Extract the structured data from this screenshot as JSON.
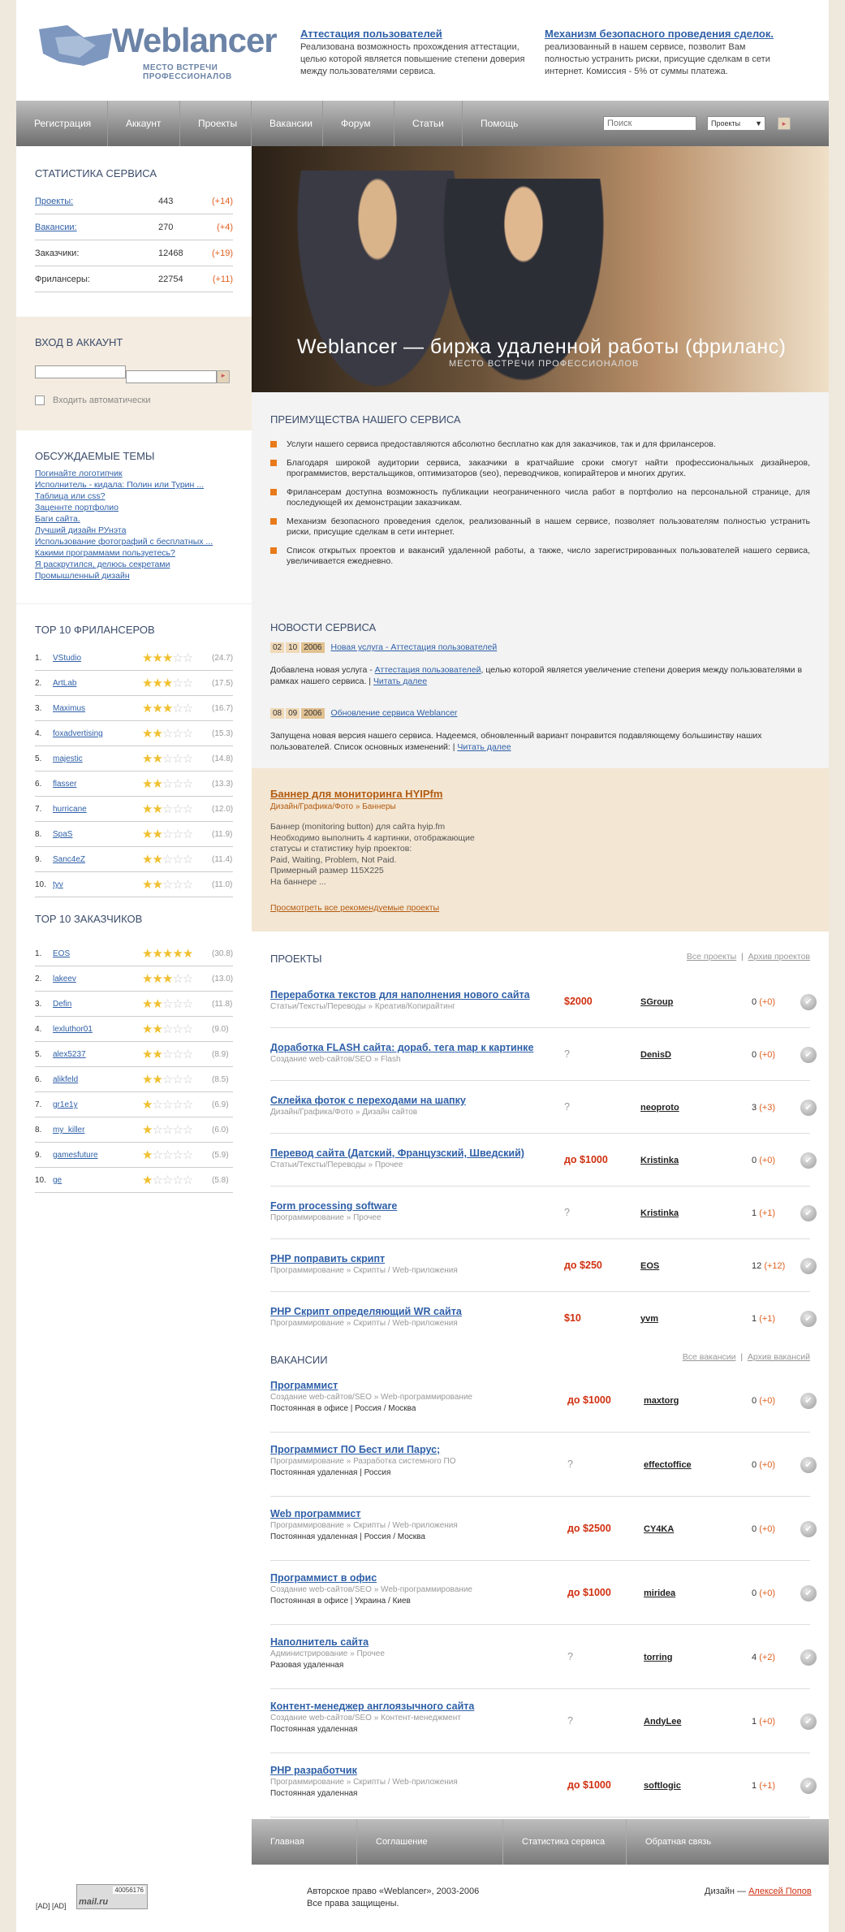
{
  "header": {
    "logo_word": "Weblancer",
    "logo_tagline": "МЕСТО ВСТРЕЧИ ПРОФЕССИОНАЛОВ",
    "promo1": {
      "title": "Аттестация пользователей",
      "text": "Реализована возможность прохождения аттестации, целью которой является повышение степени доверия между пользователями сервиса."
    },
    "promo2": {
      "title": "Механизм безопасного проведения сделок.",
      "text": "реализованный в нашем сервисе, позволит Вам полностью устранить риски, присущие сделкам в сети интернет. Комиссия - 5% от суммы платежа."
    }
  },
  "nav": {
    "items": [
      "Регистрация",
      "Аккаунт",
      "Проекты",
      "Вакансии",
      "Форум",
      "Статьи",
      "Помощь"
    ],
    "search_placeholder": "Поиск",
    "select_value": "Проекты"
  },
  "stats": {
    "title": "СТАТИСТИКА СЕРВИСА",
    "rows": [
      {
        "label": "Проекты:",
        "value": "443",
        "delta": "(+14)"
      },
      {
        "label": "Вакансии:",
        "value": "270",
        "delta": "(+4)"
      },
      {
        "label": "Заказчики:",
        "value": "12468",
        "delta": "(+19)"
      },
      {
        "label": "Фрилансеры:",
        "value": "22754",
        "delta": "(+11)"
      }
    ]
  },
  "login": {
    "title": "ВХОД В АККАУНТ",
    "auto_label": "Входить автоматически"
  },
  "topics": {
    "title": "ОБСУЖДАЕМЫЕ ТЕМЫ",
    "items": [
      "Погинайте логотипчик",
      "Исполнитель - кидала: Полин или Турин ...",
      "Таблица или css?",
      "Заценнте портфолио",
      "Баги сайта.",
      "Лучший дизайн РУнэта",
      "Использование фотографий с бесплатных ...",
      "Какими программами пользуетесь?",
      "Я раскрутился, делюсь секретами",
      "Промышленный дизайн"
    ]
  },
  "top_freelancers": {
    "title": "TOP 10 ФРИЛАНСЕРОВ",
    "rows": [
      {
        "n": "1.",
        "name": "VStudio",
        "stars": 3,
        "score": "(24.7)"
      },
      {
        "n": "2.",
        "name": "ArtLab",
        "stars": 2.5,
        "score": "(17.5)"
      },
      {
        "n": "3.",
        "name": "Maximus",
        "stars": 2.5,
        "score": "(16.7)"
      },
      {
        "n": "4.",
        "name": "foxadvertising",
        "stars": 2,
        "score": "(15.3)"
      },
      {
        "n": "5.",
        "name": "majestic",
        "stars": 2,
        "score": "(14.8)"
      },
      {
        "n": "6.",
        "name": "flasser",
        "stars": 2,
        "score": "(13.3)"
      },
      {
        "n": "7.",
        "name": "hurricane",
        "stars": 2,
        "score": "(12.0)"
      },
      {
        "n": "8.",
        "name": "SpaS",
        "stars": 2,
        "score": "(11.9)"
      },
      {
        "n": "9.",
        "name": "Sanc4eZ",
        "stars": 2,
        "score": "(11.4)"
      },
      {
        "n": "10.",
        "name": "tyv",
        "stars": 1.5,
        "score": "(11.0)"
      }
    ]
  },
  "top_clients": {
    "title": "TOP 10 ЗАКАЗЧИКОВ",
    "rows": [
      {
        "n": "1.",
        "name": "EOS",
        "stars": 5,
        "score": "(30.8)"
      },
      {
        "n": "2.",
        "name": "lakeev",
        "stars": 2.5,
        "score": "(13.0)"
      },
      {
        "n": "3.",
        "name": "Defin",
        "stars": 2,
        "score": "(11.8)"
      },
      {
        "n": "4.",
        "name": "lexluthor01",
        "stars": 1.5,
        "score": "(9.0)"
      },
      {
        "n": "5.",
        "name": "alex5237",
        "stars": 1.5,
        "score": "(8.9)"
      },
      {
        "n": "6.",
        "name": "alikfeld",
        "stars": 1.5,
        "score": "(8.5)"
      },
      {
        "n": "7.",
        "name": "gr1e1y",
        "stars": 1,
        "score": "(6.9)"
      },
      {
        "n": "8.",
        "name": "my_killer",
        "stars": 1,
        "score": "(6.0)"
      },
      {
        "n": "9.",
        "name": "gamesfuture",
        "stars": 1,
        "score": "(5.9)"
      },
      {
        "n": "10.",
        "name": "ge",
        "stars": 1,
        "score": "(5.8)"
      }
    ]
  },
  "hero": {
    "title": "Weblancer — биржа удаленной работы (фриланс)",
    "subtitle": "МЕСТО ВСТРЕЧИ ПРОФЕССИОНАЛОВ"
  },
  "advantages": {
    "title": "ПРЕИМУЩЕСТВА НАШЕГО СЕРВИСА",
    "items": [
      "Услуги нашего сервиса предоставляются абсолютно бесплатно как для заказчиков, так и для фрилансеров.",
      "Благодаря широкой аудитории сервиса, заказчики в кратчайшие сроки смогут найти профессиональных дизайнеров, программистов, верстальщиков, оптимизаторов (seo), переводчиков, копирайтеров и многих других.",
      "Фрилансерам доступна возможность публикации неограниченного числа работ в портфолио на персональной странице, для последующей их демонстрации заказчикам.",
      "Механизм безопасного проведения сделок, реализованный в нашем сервисе, позволяет пользователям полностью устранить риски, присущие сделкам в сети интернет.",
      "Список открытых проектов и вакансий удаленной работы, а также, число зарегистрированных пользователей нашего сервиса, увеличивается ежедневно."
    ]
  },
  "news": {
    "title": "НОВОСТИ СЕРВИСА",
    "items": [
      {
        "d": "02",
        "m": "10",
        "y": "2006",
        "title": "Новая услуга - Аттестация пользователей",
        "pre": "Добавлена новая услуга - ",
        "link": "Аттестация пользователей",
        "post": ", целью которой является увеличение степени доверия между пользователями в рамках нашего сервиса. |",
        "more": "Читать далее"
      },
      {
        "d": "08",
        "m": "09",
        "y": "2006",
        "title": "Обновление сервиса Weblancer",
        "pre": "Запущена новая версия нашего сервиса. Надеемся, обновленный вариант понравится подавляющему большинству наших пользователей. Список основных изменений: |",
        "link": "",
        "post": "",
        "more": "Читать далее"
      }
    ]
  },
  "recommended": {
    "title": "Баннер для мониторинга HYIPfm",
    "cat": "Дизайн/Графика/Фото » Баннеры",
    "lines": [
      "Баннер (monitoring button) для сайта hyip.fm",
      "Необходимо выполнить 4 картинки, отображающие",
      "статусы и статистику hyip проектов:",
      "Paid, Waiting, Problem, Not Paid.",
      "Примерный размер 115X225",
      "На баннере ..."
    ],
    "link": "Просмотреть все рекомендуемые проекты"
  },
  "projects": {
    "title": "ПРОЕКТЫ",
    "all": "Все проекты",
    "archive": "Архив проектов",
    "rows": [
      {
        "title": "Переработка текстов для наполнения нового сайта",
        "cat": "Статьи/Тексты/Переводы » Креатив/Копирайтинг",
        "price": "$2000",
        "user": "SGroup",
        "count": "0",
        "delta": "(+0)"
      },
      {
        "title": "Доработка FLASH сайта: дораб. тега map к картинке",
        "cat": "Создание web-сайтов/SEO » Flash",
        "price": "?",
        "user": "DenisD",
        "count": "0",
        "delta": "(+0)"
      },
      {
        "title": "Склейка фоток с переходами на шапку",
        "cat": "Дизайн/Графика/Фото » Дизайн сайтов",
        "price": "?",
        "user": "neoproto",
        "count": "3",
        "delta": "(+3)"
      },
      {
        "title": "Перевод сайта (Датский, Французский, Шведский)",
        "cat": "Статьи/Тексты/Переводы » Прочее",
        "price": "до $1000",
        "user": "Kristinka",
        "count": "0",
        "delta": "(+0)"
      },
      {
        "title": "Form processing software",
        "cat": "Программирование » Прочее",
        "price": "?",
        "user": "Kristinka",
        "count": "1",
        "delta": "(+1)"
      },
      {
        "title": "PHP поправить скрипт",
        "cat": "Программирование » Скрипты / Web-приложения",
        "price": "до $250",
        "user": "EOS",
        "count": "12",
        "delta": "(+12)"
      },
      {
        "title": "PHP Скрипт определяющий WR сайта",
        "cat": "Программирование » Скрипты / Web-приложения",
        "price": "$10",
        "user": "yvm",
        "count": "1",
        "delta": "(+1)"
      }
    ]
  },
  "vacancies": {
    "title": "ВАКАНСИИ",
    "all": "Все вакансии",
    "archive": "Архив вакансий",
    "rows": [
      {
        "title": "Программист",
        "cat": "Создание web-сайтов/SEO » Web-программирование",
        "info": "Постоянная в офисе | Россия / Москва",
        "price": "до $1000",
        "user": "maxtorg",
        "count": "0",
        "delta": "(+0)"
      },
      {
        "title": "Программист ПО Бест или Парус;",
        "cat": "Программирование » Разработка системного ПО",
        "info": "Постоянная удаленная | Россия",
        "price": "?",
        "user": "effectoffice",
        "count": "0",
        "delta": "(+0)"
      },
      {
        "title": "Web программист",
        "cat": "Программирование » Скрипты / Web-приложения",
        "info": "Постоянная удаленная | Россия / Москва",
        "price": "до $2500",
        "user": "CY4KA",
        "count": "0",
        "delta": "(+0)"
      },
      {
        "title": "Программист в офис",
        "cat": "Создание web-сайтов/SEO » Web-программирование",
        "info": "Постоянная в офисе | Украина / Киев",
        "price": "до $1000",
        "user": "miridea",
        "count": "0",
        "delta": "(+0)"
      },
      {
        "title": "Наполнитель сайта",
        "cat": "Администрирование » Прочее",
        "info": "Разовая удаленная",
        "price": "?",
        "user": "torring",
        "count": "4",
        "delta": "(+2)"
      },
      {
        "title": "Контент-менеджер англоязычного сайта",
        "cat": "Создание web-сайтов/SEO » Контент-менеджмент",
        "info": "Постоянная удаленная",
        "price": "?",
        "user": "AndyLee",
        "count": "1",
        "delta": "(+0)"
      },
      {
        "title": "PHP разработчик",
        "cat": "Программирование » Скрипты / Web-приложения",
        "info": "Постоянная удаленная",
        "price": "до $1000",
        "user": "softlogic",
        "count": "1",
        "delta": "(+1)"
      }
    ]
  },
  "footer": {
    "nav": [
      "Главная страница",
      "Соглашение пользователя",
      "Статистика сервиса",
      "Обратная связь"
    ],
    "copyright1": "Авторское право «Weblancer», 2003-2006",
    "copyright2": "Все права защищены.",
    "design_label": "Дизайн —",
    "designer": "Алексей Попов",
    "counter": "40056176",
    "ad": "[AD] [AD]"
  },
  "colors": {
    "accent": "#e87a1a",
    "link": "#2f60a8",
    "price": "#d03010"
  }
}
